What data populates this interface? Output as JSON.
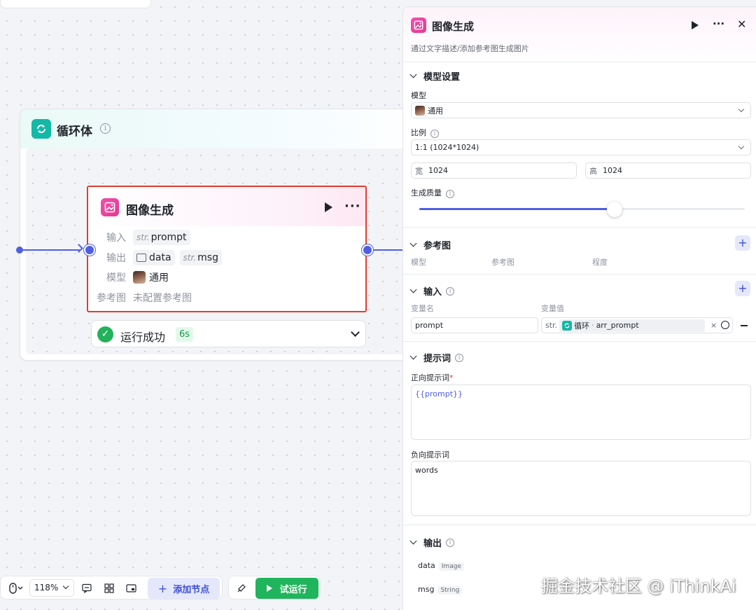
{
  "canvas": {
    "loop": {
      "title": "循环体"
    },
    "node": {
      "title": "图像生成",
      "input_label": "输入",
      "input_type": "str.",
      "input_value": "prompt",
      "output_label": "输出",
      "output_data": "data",
      "output_type": "str.",
      "output_msg": "msg",
      "model_label": "模型",
      "model_value": "通用",
      "ref_label": "参考图",
      "ref_value": "未配置参考图"
    },
    "status": {
      "text": "运行成功",
      "time": "6s"
    }
  },
  "toolbar": {
    "zoom": "118%",
    "add_node": "添加节点",
    "run": "试运行"
  },
  "panel": {
    "title": "图像生成",
    "description": "通过文字描述/添加参考图生成图片",
    "model_settings": {
      "header": "模型设置",
      "model_label": "模型",
      "model_value": "通用",
      "ratio_label": "比例",
      "ratio_value": "1:1 (1024*1024)",
      "width_label": "宽",
      "width_value": "1024",
      "height_label": "高",
      "height_value": "1024",
      "quality_label": "生成质量",
      "quality_level": 0.6
    },
    "reference": {
      "header": "参考图",
      "columns": [
        "模型",
        "参考图",
        "程度"
      ]
    },
    "input": {
      "header": "输入",
      "col_name": "变量名",
      "col_value": "变量值",
      "var_name": "prompt",
      "var_type": "str.",
      "var_source": "循环",
      "var_ref": "arr_prompt"
    },
    "prompt": {
      "header": "提示词",
      "positive_label": "正向提示词",
      "required_mark": "*",
      "positive_value": "{{prompt}}",
      "negative_label": "负向提示词",
      "negative_value": "words"
    },
    "output": {
      "header": "输出",
      "items": [
        {
          "name": "data",
          "type": "Image"
        },
        {
          "name": "msg",
          "type": "String"
        }
      ]
    }
  },
  "watermark": "掘金技术社区 @ iThinkAi",
  "colors": {
    "accent": "#4e5ee4",
    "success": "#22b25a",
    "highlight_border": "#e23c2f",
    "loop_icon": "#14b8a6",
    "image_icon": "#e33a8c"
  }
}
